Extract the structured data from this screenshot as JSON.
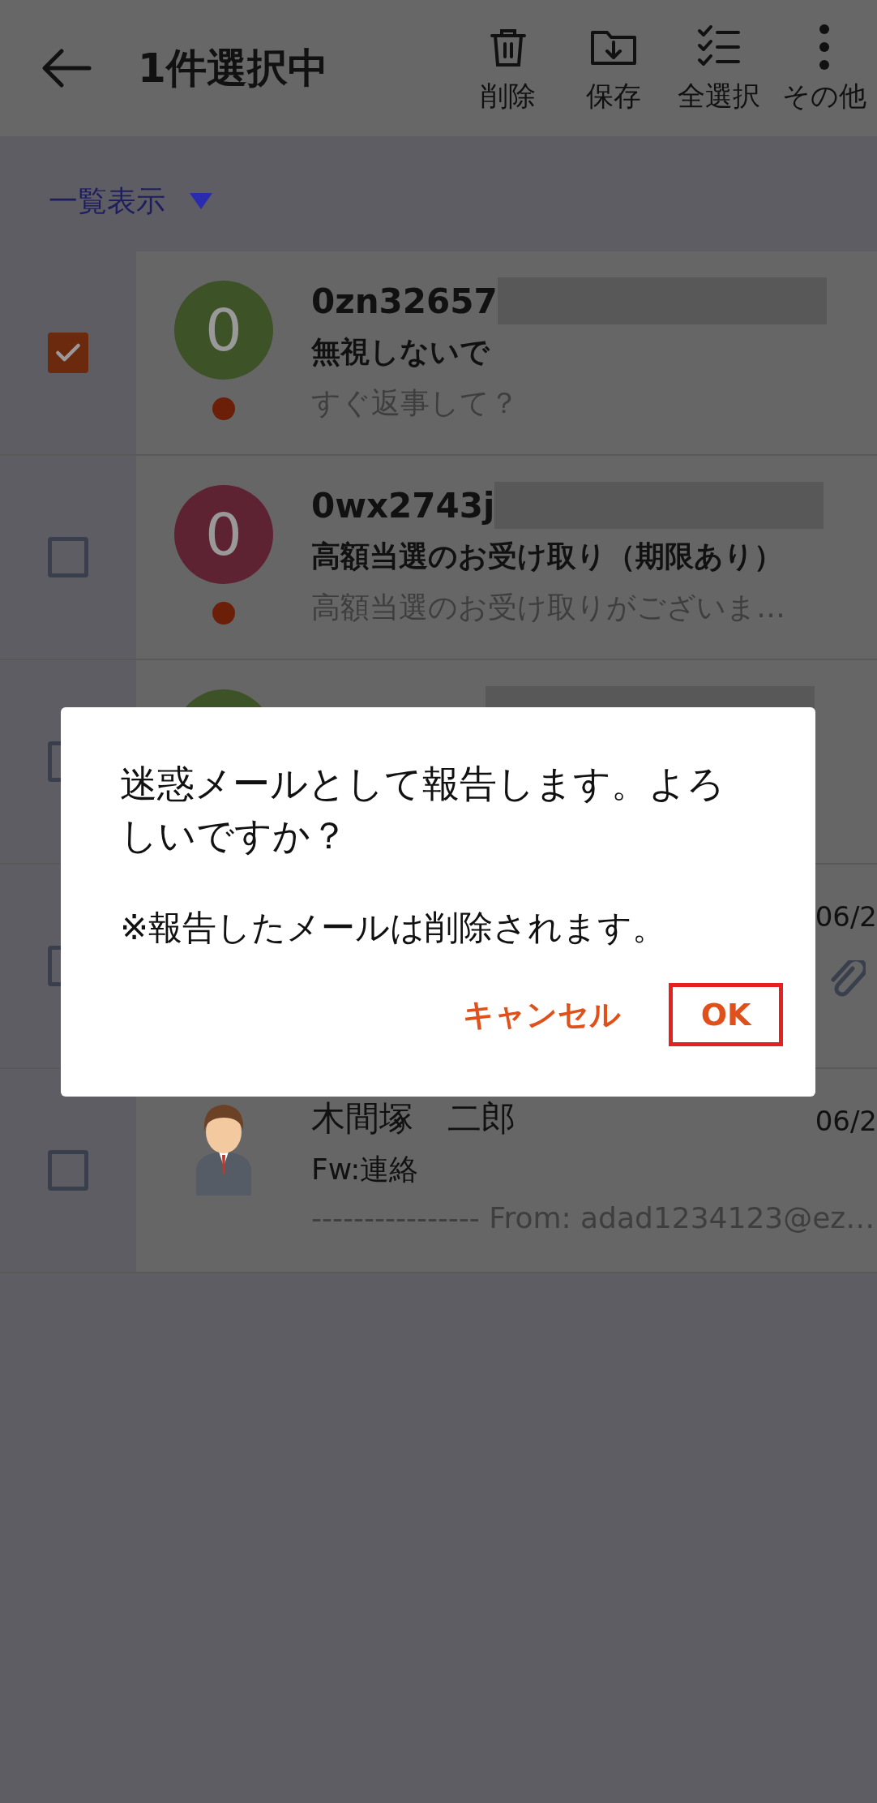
{
  "app_bar": {
    "title": "1件選択中",
    "actions": [
      {
        "kind": "delete",
        "label": "削除"
      },
      {
        "kind": "save",
        "label": "保存"
      },
      {
        "kind": "select_all",
        "label": "全選択"
      },
      {
        "kind": "more",
        "label": "その他"
      }
    ]
  },
  "view_selector": {
    "label": "一覧表示"
  },
  "messages": [
    {
      "checked": true,
      "avatar": {
        "kind": "initial",
        "initial": "0",
        "color": "#3d5227"
      },
      "unread": true,
      "sender": "0zn32657",
      "redacted": true,
      "subject": "無視しないで",
      "preview": "すぐ返事して？"
    },
    {
      "checked": false,
      "avatar": {
        "kind": "initial",
        "initial": "0",
        "color": "#5e2333"
      },
      "unread": true,
      "sender": "0wx2743j",
      "redacted": true,
      "subject": "高額当選のお受け取り（期限あり）",
      "preview": "高額当選のお受け取りがございま…"
    },
    {
      "checked": false,
      "avatar": {
        "kind": "initial",
        "color": "#3d5227"
      },
      "redacted": true
    },
    {
      "checked": false,
      "date": "06/2",
      "attachment": true
    },
    {
      "checked": false,
      "avatar": {
        "kind": "person"
      },
      "unread": false,
      "sender": "木間塚　二郎",
      "date": "06/2",
      "subject": "Fw:連絡",
      "preview": "---------------- From: adad1234123@ez…"
    }
  ],
  "dialog": {
    "message": "迷惑メールとして報告します。よろしいですか？",
    "note": "※報告したメールは削除されます。",
    "buttons": [
      {
        "label": "キャンセル",
        "highlighted": false
      },
      {
        "label": "OK",
        "highlighted": true
      }
    ]
  }
}
